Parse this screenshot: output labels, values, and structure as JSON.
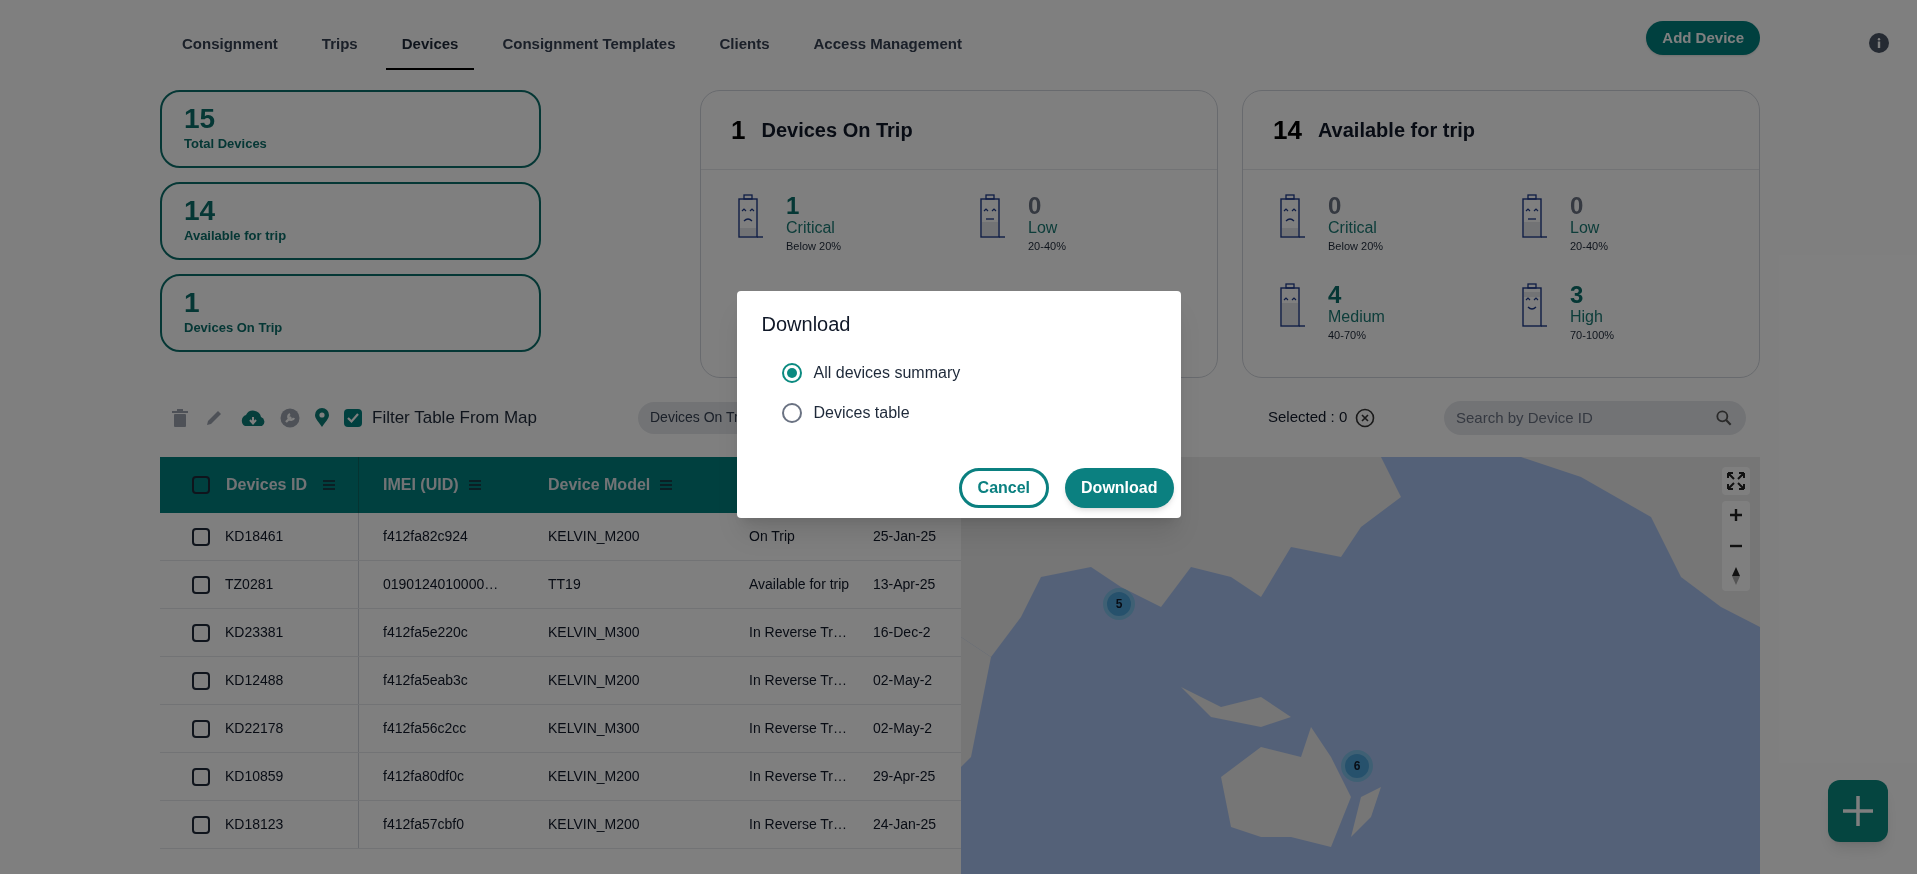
{
  "tabs": [
    {
      "label": "Consignment",
      "selected": false
    },
    {
      "label": "Trips",
      "selected": false
    },
    {
      "label": "Devices",
      "selected": true
    },
    {
      "label": "Consignment Templates",
      "selected": false
    },
    {
      "label": "Clients",
      "selected": false
    },
    {
      "label": "Access Management",
      "selected": false
    }
  ],
  "add_button": "Add Device",
  "summary_cards": [
    {
      "value": "15",
      "label": "Total Devices"
    },
    {
      "value": "14",
      "label": "Available for trip"
    },
    {
      "value": "1",
      "label": "Devices On Trip"
    }
  ],
  "battery_panels": [
    {
      "count": "1",
      "title": "Devices On Trip",
      "levels": [
        {
          "kind": "critical",
          "count": "1",
          "empty": false,
          "label": "Critical",
          "range": "Below 20%"
        },
        {
          "kind": "low",
          "count": "0",
          "empty": true,
          "label": "Low",
          "range": "20-40%"
        }
      ]
    },
    {
      "count": "14",
      "title": "Available for trip",
      "levels": [
        {
          "kind": "critical",
          "count": "0",
          "empty": true,
          "label": "Critical",
          "range": "Below 20%"
        },
        {
          "kind": "low",
          "count": "0",
          "empty": true,
          "label": "Low",
          "range": "20-40%"
        },
        {
          "kind": "medium",
          "count": "4",
          "empty": false,
          "label": "Medium",
          "range": "40-70%"
        },
        {
          "kind": "high",
          "count": "3",
          "empty": false,
          "label": "High",
          "range": "70-100%"
        }
      ]
    }
  ],
  "toolbar": {
    "icons": [
      {
        "kind": "trash",
        "disabled": true
      },
      {
        "kind": "pencil",
        "disabled": true
      },
      {
        "kind": "download",
        "disabled": false
      },
      {
        "kind": "wrench",
        "disabled": true
      },
      {
        "kind": "pin",
        "disabled": false
      }
    ],
    "filter_checkbox": {
      "label": "Filter Table From Map",
      "checked": true
    },
    "filter_chip": "Devices On Tr",
    "selected_text": "Selected : 0",
    "search": {
      "placeholder": "Search by Device ID"
    }
  },
  "table": {
    "all_checked": false,
    "columns": [
      "Devices ID",
      "IMEI (UID)",
      "Device Model"
    ],
    "rows": [
      {
        "checked": false,
        "cells": [
          "KD18461",
          "f412fa82c924",
          "KELVIN_M200",
          "On Trip",
          "25-Jan-25"
        ]
      },
      {
        "checked": false,
        "cells": [
          "TZ0281",
          "0190124010000…",
          "TT19",
          "Available for trip",
          "13-Apr-25"
        ]
      },
      {
        "checked": false,
        "cells": [
          "KD23381",
          "f412fa5e220c",
          "KELVIN_M300",
          "In Reverse Tr…",
          "16-Dec-2"
        ]
      },
      {
        "checked": false,
        "cells": [
          "KD12488",
          "f412fa5eab3c",
          "KELVIN_M200",
          "In Reverse Tr…",
          "02-May-2"
        ]
      },
      {
        "checked": false,
        "cells": [
          "KD22178",
          "f412fa56c2cc",
          "KELVIN_M300",
          "In Reverse Tr…",
          "02-May-2"
        ]
      },
      {
        "checked": false,
        "cells": [
          "KD10859",
          "f412fa80df0c",
          "KELVIN_M200",
          "In Reverse Tr…",
          "29-Apr-25"
        ]
      },
      {
        "checked": false,
        "cells": [
          "KD18123",
          "f412fa57cbf0",
          "KELVIN_M200",
          "In Reverse Tr…",
          "24-Jan-25"
        ]
      }
    ]
  },
  "map": {
    "clusters": [
      {
        "count": "5"
      },
      {
        "count": "6"
      }
    ]
  },
  "dialog": {
    "title": "Download",
    "options": [
      {
        "label": "All devices summary",
        "selected": true
      },
      {
        "label": "Devices table",
        "selected": false
      }
    ],
    "buttons": [
      {
        "label": "Cancel",
        "kind": "outline"
      },
      {
        "label": "Download",
        "kind": "filled"
      }
    ]
  }
}
